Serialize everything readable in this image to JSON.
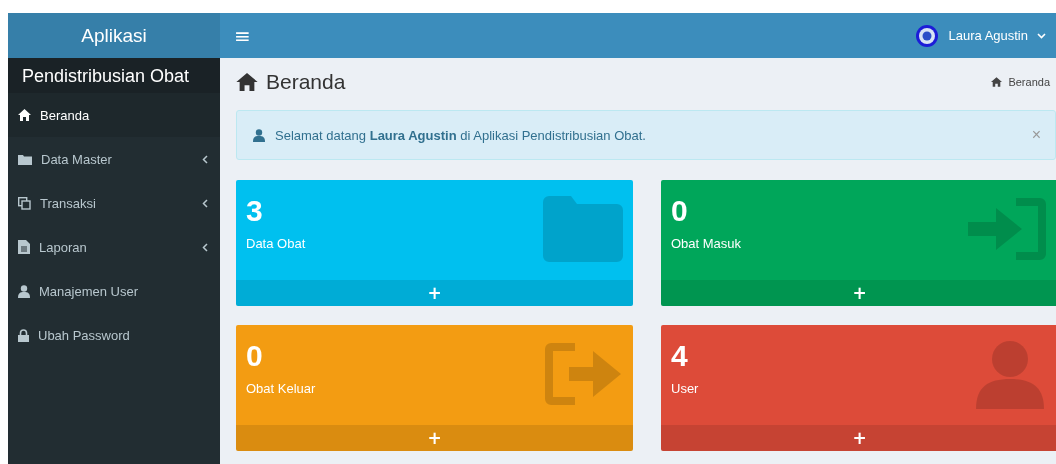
{
  "brand": "Aplikasi",
  "sidebar": {
    "title": "Pendistribusian Obat",
    "items": [
      {
        "label": "Beranda",
        "kind": "home",
        "selected": true,
        "submenu": false
      },
      {
        "label": "Data Master",
        "kind": "folder",
        "selected": false,
        "submenu": true
      },
      {
        "label": "Transaksi",
        "kind": "copy",
        "selected": false,
        "submenu": true
      },
      {
        "label": "Laporan",
        "kind": "file",
        "selected": false,
        "submenu": true
      },
      {
        "label": "Manajemen User",
        "kind": "user",
        "selected": false,
        "submenu": false
      },
      {
        "label": "Ubah Password",
        "kind": "lock",
        "selected": false,
        "submenu": false
      }
    ]
  },
  "header": {
    "menu_icon": "≡",
    "user": "Laura Agustin"
  },
  "page_title": "Beranda",
  "breadcrumb": "Beranda",
  "alert": {
    "text": "Selamat datang **Laura Agustin** di Aplikasi Pendistribusian Obat.",
    "close": "×"
  },
  "boxes": [
    {
      "value": "3",
      "label": "Data Obat",
      "color": "#00c0ef",
      "kind": "folder",
      "footer": "+"
    },
    {
      "value": "0",
      "label": "Obat Masuk",
      "color": "#00a65a",
      "kind": "signin",
      "footer": "+"
    },
    {
      "value": "0",
      "label": "Obat Keluar",
      "color": "#f39c12",
      "kind": "signout",
      "footer": "+"
    },
    {
      "value": "4",
      "label": "User",
      "color": "#dd4b39",
      "kind": "user",
      "footer": "+"
    }
  ]
}
